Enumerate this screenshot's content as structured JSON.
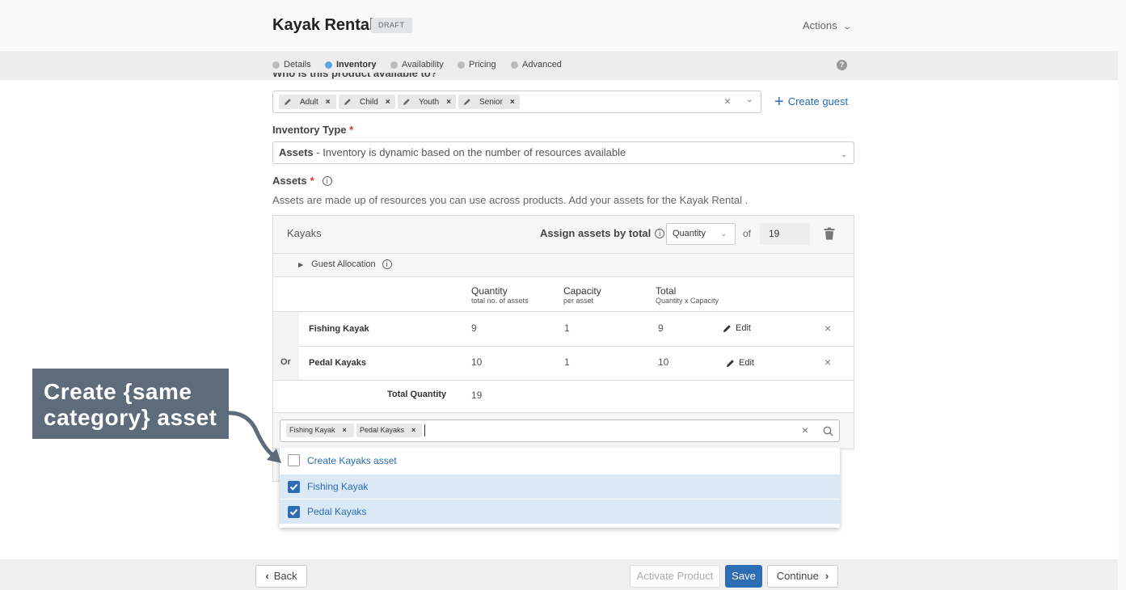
{
  "header": {
    "title": "Kayak Rental",
    "badge": "DRAFT",
    "actions": "Actions"
  },
  "steps": [
    {
      "label": "Details",
      "active": false
    },
    {
      "label": "Inventory",
      "active": true
    },
    {
      "label": "Availability",
      "active": false
    },
    {
      "label": "Pricing",
      "active": false
    },
    {
      "label": "Advanced",
      "active": false
    }
  ],
  "help": "?",
  "guests": {
    "label": "Who is this product available to?",
    "chips": [
      "Adult",
      "Child",
      "Youth",
      "Senior"
    ],
    "create": "Create guest"
  },
  "inventory_type": {
    "label": "Inventory Type",
    "value_bold": "Assets",
    "value_rest": " - Inventory is dynamic based on the number of resources available"
  },
  "assets": {
    "label": "Assets",
    "description": "Assets are made up of resources you can use across products. Add your assets for the Kayak Rental ."
  },
  "panel": {
    "name": "Kayaks",
    "assign_label": "Assign assets by total",
    "assign_mode": "Quantity",
    "of": "of",
    "total_value": "19",
    "guest_allocation": "Guest Allocation",
    "columns": [
      {
        "title": "Quantity",
        "sub": "total no. of assets"
      },
      {
        "title": "Capacity",
        "sub": "per asset"
      },
      {
        "title": "Total",
        "sub": "Quantity x Capacity"
      }
    ],
    "rows": [
      {
        "prefix": "",
        "name": "Fishing Kayak",
        "quantity": "9",
        "capacity": "1",
        "total": "9",
        "edit": "Edit"
      },
      {
        "prefix": "Or",
        "name": "Pedal Kayaks",
        "quantity": "10",
        "capacity": "1",
        "total": "10",
        "edit": "Edit"
      }
    ],
    "total_label": "Total Quantity",
    "total_quantity": "19"
  },
  "combo": {
    "chips": [
      "Fishing Kayak",
      "Pedal Kayaks"
    ]
  },
  "dropdown": [
    {
      "label": "Create Kayaks asset",
      "checked": false
    },
    {
      "label": "Fishing Kayak",
      "checked": true
    },
    {
      "label": "Pedal Kayaks",
      "checked": true
    }
  ],
  "callout": {
    "line1": "Create {same",
    "line2": "category} asset"
  },
  "footer": {
    "back": "Back",
    "activate": "Activate Product",
    "save": "Save",
    "continue": "Continue"
  },
  "colors": {
    "accent": "#2d6db5",
    "link": "#2a6bb3",
    "callout": "#5d6b7b",
    "active_step": "#5aa6dc"
  }
}
